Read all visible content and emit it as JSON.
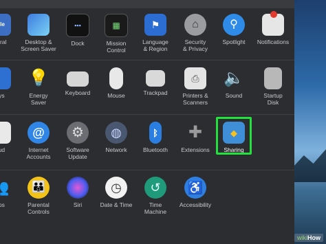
{
  "rows": [
    [
      {
        "label": "neral",
        "icon": "general-icon"
      },
      {
        "label": "Desktop &\nScreen Saver",
        "icon": "desktop-screensaver-icon"
      },
      {
        "label": "Dock",
        "icon": "dock-icon"
      },
      {
        "label": "Mission\nControl",
        "icon": "mission-control-icon"
      },
      {
        "label": "Language\n& Region",
        "icon": "language-region-icon"
      },
      {
        "label": "Security\n& Privacy",
        "icon": "security-privacy-icon"
      },
      {
        "label": "Spotlight",
        "icon": "spotlight-icon"
      },
      {
        "label": "Notifications",
        "icon": "notifications-icon"
      }
    ],
    [
      {
        "label": "ays",
        "icon": "displays-icon"
      },
      {
        "label": "Energy\nSaver",
        "icon": "energy-saver-icon"
      },
      {
        "label": "Keyboard",
        "icon": "keyboard-icon"
      },
      {
        "label": "Mouse",
        "icon": "mouse-icon"
      },
      {
        "label": "Trackpad",
        "icon": "trackpad-icon"
      },
      {
        "label": "Printers &\nScanners",
        "icon": "printers-scanners-icon"
      },
      {
        "label": "Sound",
        "icon": "sound-icon"
      },
      {
        "label": "Startup\nDisk",
        "icon": "startup-disk-icon"
      }
    ],
    [
      {
        "label": "oud",
        "icon": "icloud-icon"
      },
      {
        "label": "Internet\nAccounts",
        "icon": "internet-accounts-icon"
      },
      {
        "label": "Software\nUpdate",
        "icon": "software-update-icon"
      },
      {
        "label": "Network",
        "icon": "network-icon"
      },
      {
        "label": "Bluetooth",
        "icon": "bluetooth-icon"
      },
      {
        "label": "Extensions",
        "icon": "extensions-icon"
      },
      {
        "label": "Sharing",
        "icon": "sharing-icon"
      }
    ],
    [
      {
        "label": "ups",
        "icon": "users-groups-icon"
      },
      {
        "label": "Parental\nControls",
        "icon": "parental-controls-icon"
      },
      {
        "label": "Siri",
        "icon": "siri-icon"
      },
      {
        "label": "Date & Time",
        "icon": "date-time-icon"
      },
      {
        "label": "Time\nMachine",
        "icon": "time-machine-icon"
      },
      {
        "label": "Accessibility",
        "icon": "accessibility-icon"
      }
    ]
  ],
  "watermark": {
    "prefix": "wiki",
    "suffix": "How"
  },
  "colors": {
    "highlight": "#23e23d",
    "background": "#2c2d30"
  }
}
